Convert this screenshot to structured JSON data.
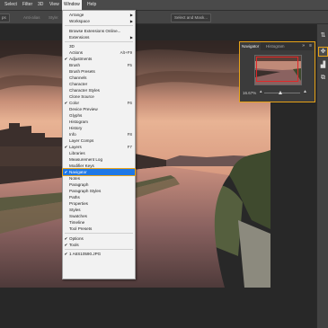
{
  "menubar": {
    "items": [
      {
        "label": "Select"
      },
      {
        "label": "Filter"
      },
      {
        "label": "3D"
      },
      {
        "label": "View"
      },
      {
        "label": "Window"
      },
      {
        "label": "Help"
      }
    ]
  },
  "options_bar": {
    "left_button": "ps",
    "dim1": "Anti-alias",
    "style_label": "Style:",
    "select_mask": "Select and Mask..."
  },
  "window_menu": {
    "items": [
      {
        "label": "Arrange",
        "shortcut": "",
        "checked": false,
        "submenu": true
      },
      {
        "label": "Workspace",
        "shortcut": "",
        "checked": false,
        "submenu": true
      },
      {
        "sep": true
      },
      {
        "label": "Browse Extensions Online...",
        "shortcut": "",
        "checked": false
      },
      {
        "label": "Extensions",
        "shortcut": "",
        "checked": false,
        "submenu": true
      },
      {
        "sep": true
      },
      {
        "label": "3D",
        "shortcut": "",
        "checked": false
      },
      {
        "label": "Actions",
        "shortcut": "Alt+F9",
        "checked": false
      },
      {
        "label": "Adjustments",
        "shortcut": "",
        "checked": true
      },
      {
        "label": "Brush",
        "shortcut": "F5",
        "checked": false
      },
      {
        "label": "Brush Presets",
        "shortcut": "",
        "checked": false
      },
      {
        "label": "Channels",
        "shortcut": "",
        "checked": false
      },
      {
        "label": "Character",
        "shortcut": "",
        "checked": false
      },
      {
        "label": "Character Styles",
        "shortcut": "",
        "checked": false
      },
      {
        "label": "Clone Source",
        "shortcut": "",
        "checked": false
      },
      {
        "label": "Color",
        "shortcut": "F6",
        "checked": true
      },
      {
        "label": "Device Preview",
        "shortcut": "",
        "checked": false
      },
      {
        "label": "Glyphs",
        "shortcut": "",
        "checked": false
      },
      {
        "label": "Histogram",
        "shortcut": "",
        "checked": false
      },
      {
        "label": "History",
        "shortcut": "",
        "checked": false
      },
      {
        "label": "Info",
        "shortcut": "F8",
        "checked": false
      },
      {
        "label": "Layer Comps",
        "shortcut": "",
        "checked": false
      },
      {
        "label": "Layers",
        "shortcut": "F7",
        "checked": true
      },
      {
        "label": "Libraries",
        "shortcut": "",
        "checked": false
      },
      {
        "label": "Measurement Log",
        "shortcut": "",
        "checked": false
      },
      {
        "label": "Modifier Keys",
        "shortcut": "",
        "checked": false
      },
      {
        "label": "Navigator",
        "shortcut": "",
        "checked": true,
        "highlighted": true
      },
      {
        "label": "Notes",
        "shortcut": "",
        "checked": false
      },
      {
        "label": "Paragraph",
        "shortcut": "",
        "checked": false
      },
      {
        "label": "Paragraph Styles",
        "shortcut": "",
        "checked": false
      },
      {
        "label": "Paths",
        "shortcut": "",
        "checked": false
      },
      {
        "label": "Properties",
        "shortcut": "",
        "checked": false
      },
      {
        "label": "Styles",
        "shortcut": "",
        "checked": false
      },
      {
        "label": "Swatches",
        "shortcut": "",
        "checked": false
      },
      {
        "label": "Timeline",
        "shortcut": "",
        "checked": false
      },
      {
        "label": "Tool Presets",
        "shortcut": "",
        "checked": false
      },
      {
        "sep": true
      },
      {
        "label": "Options",
        "shortcut": "",
        "checked": true
      },
      {
        "label": "Tools",
        "shortcut": "",
        "checked": true
      },
      {
        "sep": true
      },
      {
        "label": "1 A6S10590.JPG",
        "shortcut": "",
        "checked": true
      }
    ]
  },
  "navigator": {
    "tab_navigator": "Navigator",
    "tab_histogram": "Histogram",
    "more": "»",
    "menu": "≡",
    "zoom": "16.67%",
    "zoom_fraction": 0.45
  },
  "right_strip": {
    "icons": [
      "arrange-icon",
      "navigator-icon",
      "histogram-icon",
      "clone-icon"
    ]
  },
  "colors": {
    "accent": "#e8a317",
    "highlight": "#1f78e6",
    "nav_box": "#e0282a"
  }
}
